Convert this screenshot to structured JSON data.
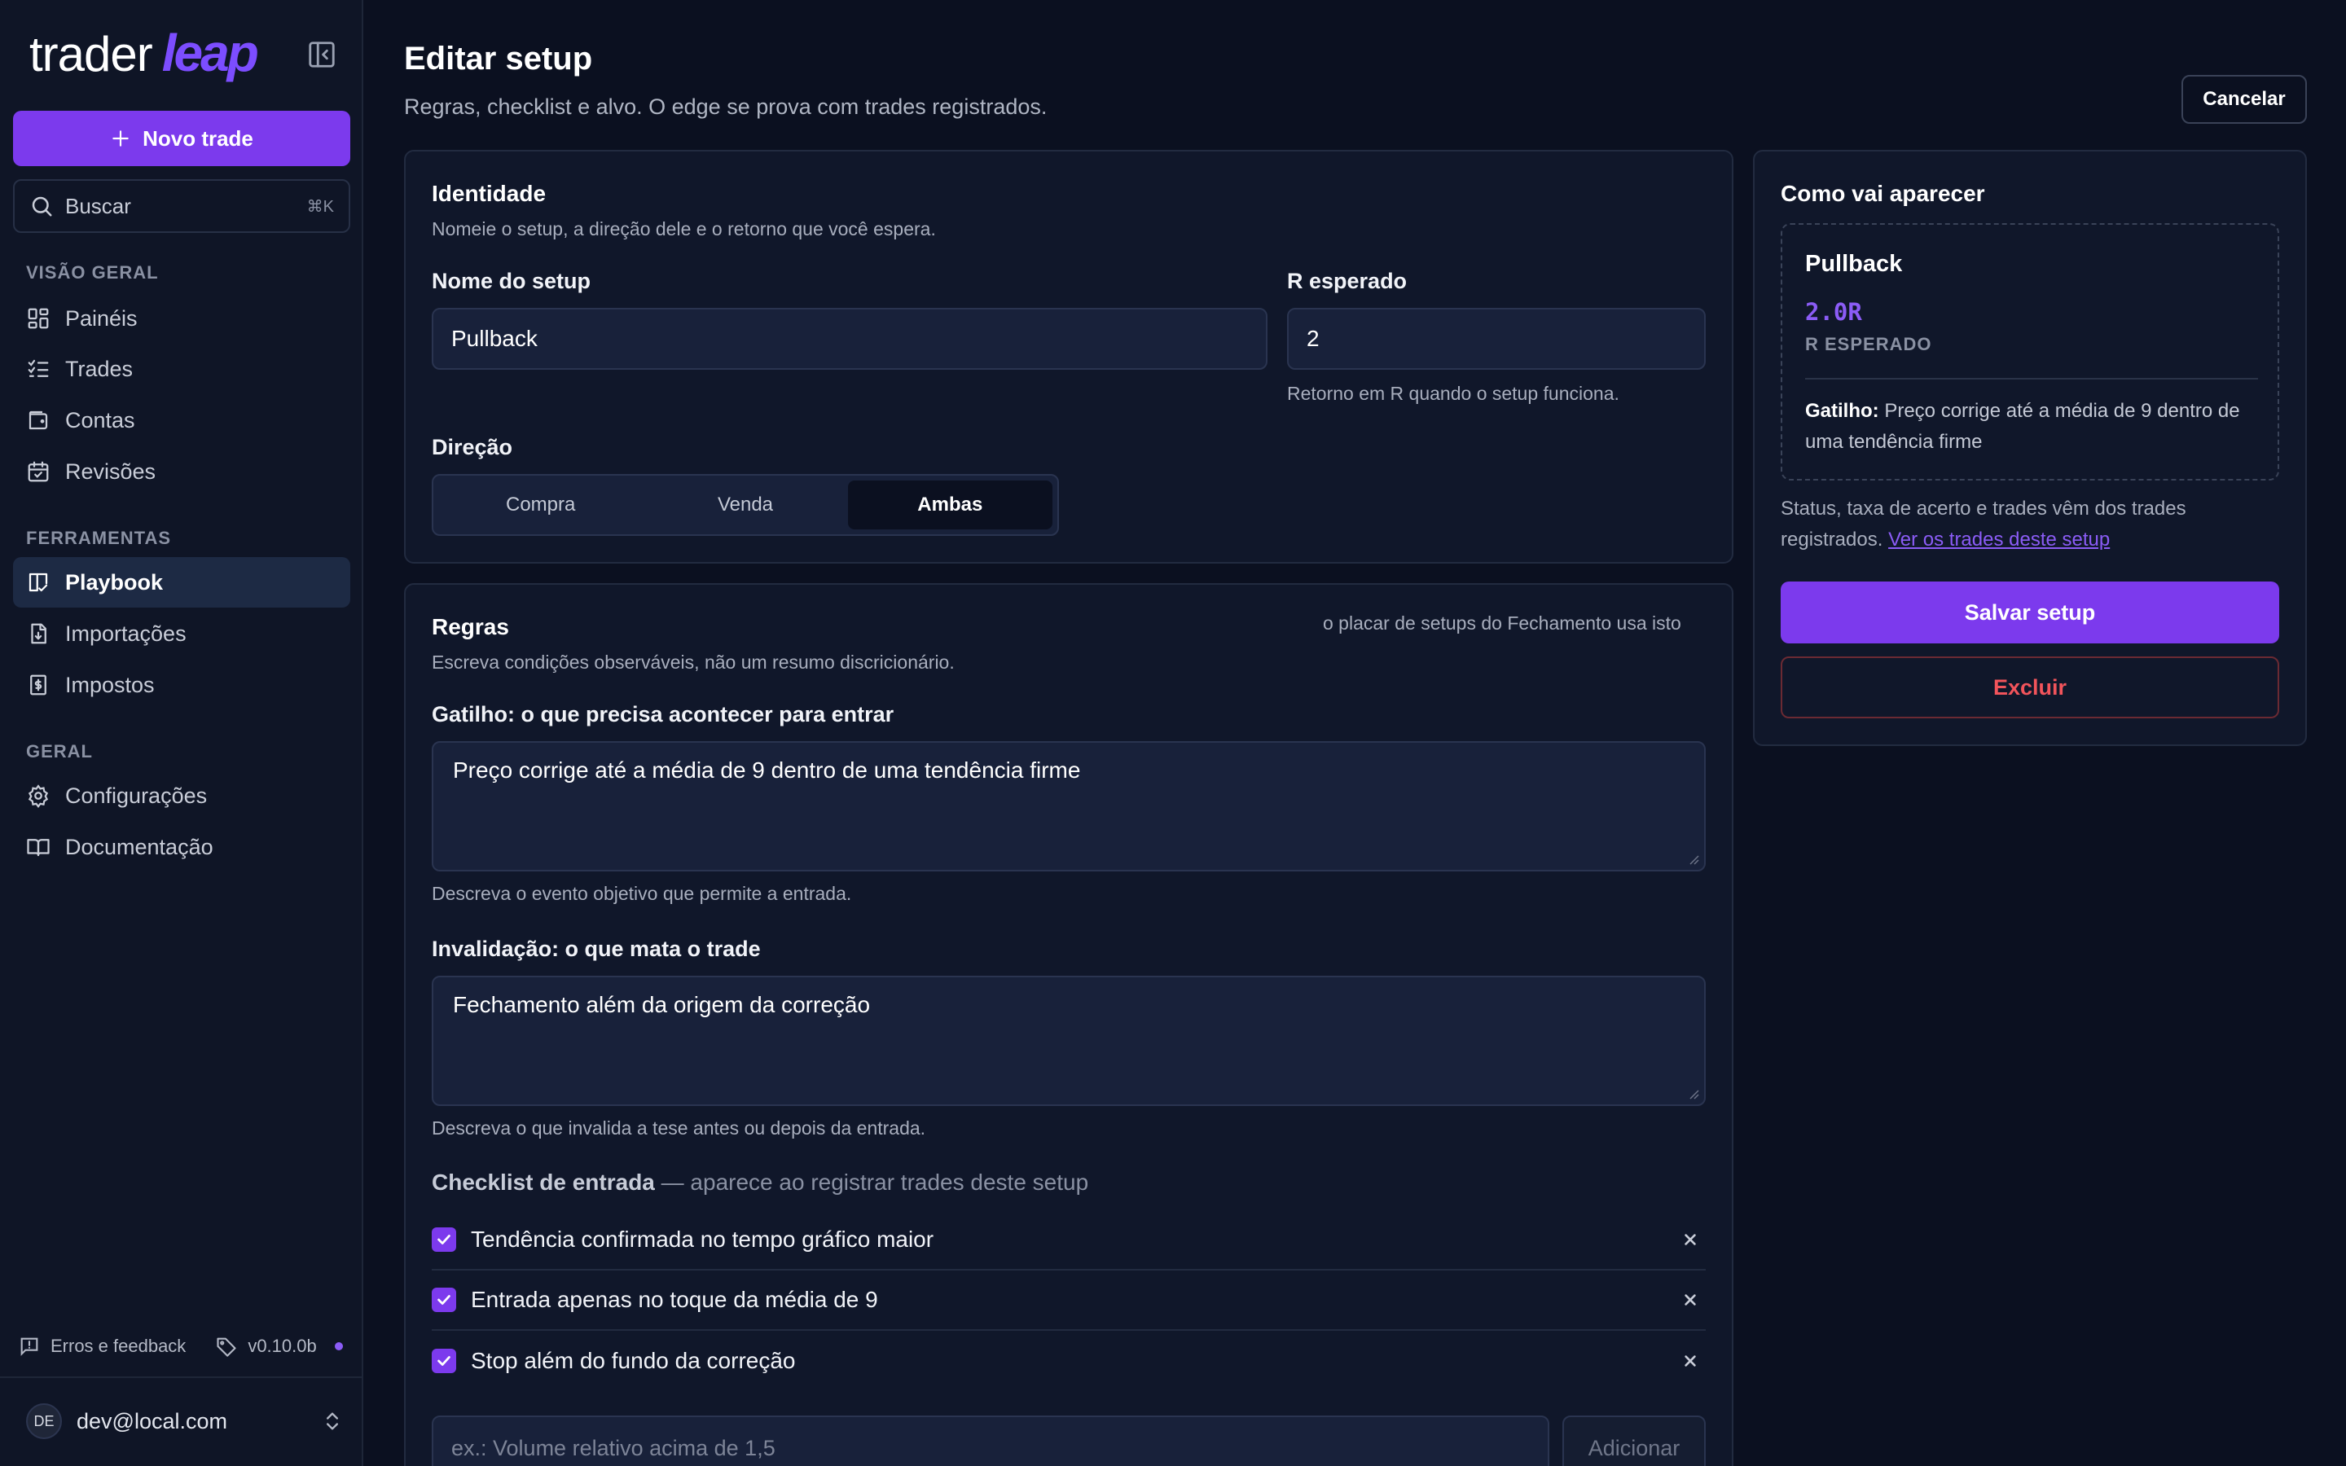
{
  "brand": {
    "word1": "trader",
    "word2": "leap"
  },
  "sidebar": {
    "new_trade_label": "Novo trade",
    "search": {
      "placeholder": "Buscar",
      "shortcut": "⌘K"
    },
    "sections": [
      {
        "title": "VISÃO GERAL",
        "items": [
          {
            "label": "Painéis",
            "icon": "layout-grid-icon"
          },
          {
            "label": "Trades",
            "icon": "list-checks-icon"
          },
          {
            "label": "Contas",
            "icon": "wallet-icon"
          },
          {
            "label": "Revisões",
            "icon": "calendar-check-icon"
          }
        ]
      },
      {
        "title": "FERRAMENTAS",
        "items": [
          {
            "label": "Playbook",
            "icon": "book-check-icon",
            "active": true
          },
          {
            "label": "Importações",
            "icon": "file-import-icon"
          },
          {
            "label": "Impostos",
            "icon": "receipt-dollar-icon"
          }
        ]
      },
      {
        "title": "GERAL",
        "items": [
          {
            "label": "Configurações",
            "icon": "gear-icon"
          },
          {
            "label": "Documentação",
            "icon": "book-open-icon"
          }
        ]
      }
    ],
    "footer": {
      "feedback_label": "Erros e feedback",
      "version": "v0.10.0b"
    },
    "user": {
      "initials": "DE",
      "email": "dev@local.com"
    }
  },
  "header": {
    "title": "Editar setup",
    "subtitle": "Regras, checklist e alvo. O edge se prova com trades registrados.",
    "cancel_label": "Cancelar"
  },
  "identity": {
    "title": "Identidade",
    "desc": "Nomeie o setup, a direção dele e o retorno que você espera.",
    "name_label": "Nome do setup",
    "name_value": "Pullback",
    "r_label": "R esperado",
    "r_value": "2",
    "r_hint": "Retorno em R quando o setup funciona.",
    "direction_label": "Direção",
    "direction_options": [
      "Compra",
      "Venda",
      "Ambas"
    ],
    "direction_selected": "Ambas"
  },
  "rules": {
    "title": "Regras",
    "desc": "Escreva condições observáveis, não um resumo discricionário.",
    "right_note": "o placar de setups do Fechamento usa isto",
    "trigger_label": "Gatilho: o que precisa acontecer para entrar",
    "trigger_value": "Preço corrige até a média de 9 dentro de uma tendência firme",
    "trigger_hint": "Descreva o evento objetivo que permite a entrada.",
    "invalidation_label": "Invalidação: o que mata o trade",
    "invalidation_value": "Fechamento além da origem da correção",
    "invalidation_hint": "Descreva o que invalida a tese antes ou depois da entrada.",
    "checklist_title": "Checklist de entrada",
    "checklist_sub": " — aparece ao registrar trades deste setup",
    "checklist": [
      "Tendência confirmada no tempo gráfico maior",
      "Entrada apenas no toque da média de 9",
      "Stop além do fundo da correção"
    ],
    "add_placeholder": "ex.: Volume relativo acima de 1,5",
    "add_label": "Adicionar"
  },
  "preview": {
    "title": "Como vai aparecer",
    "name": "Pullback",
    "r_display": "2.0R",
    "r_caption": "R ESPERADO",
    "trigger_prefix": "Gatilho:",
    "trigger_text": " Preço corrige até a média de 9 dentro de uma tendência firme",
    "note": "Status, taxa de acerto e trades vêm dos trades registrados. ",
    "note_link": "Ver os trades deste setup",
    "save_label": "Salvar setup",
    "delete_label": "Excluir"
  },
  "colors": {
    "accent": "#7c3aed",
    "background": "#0b1020",
    "danger": "#f2545b"
  }
}
